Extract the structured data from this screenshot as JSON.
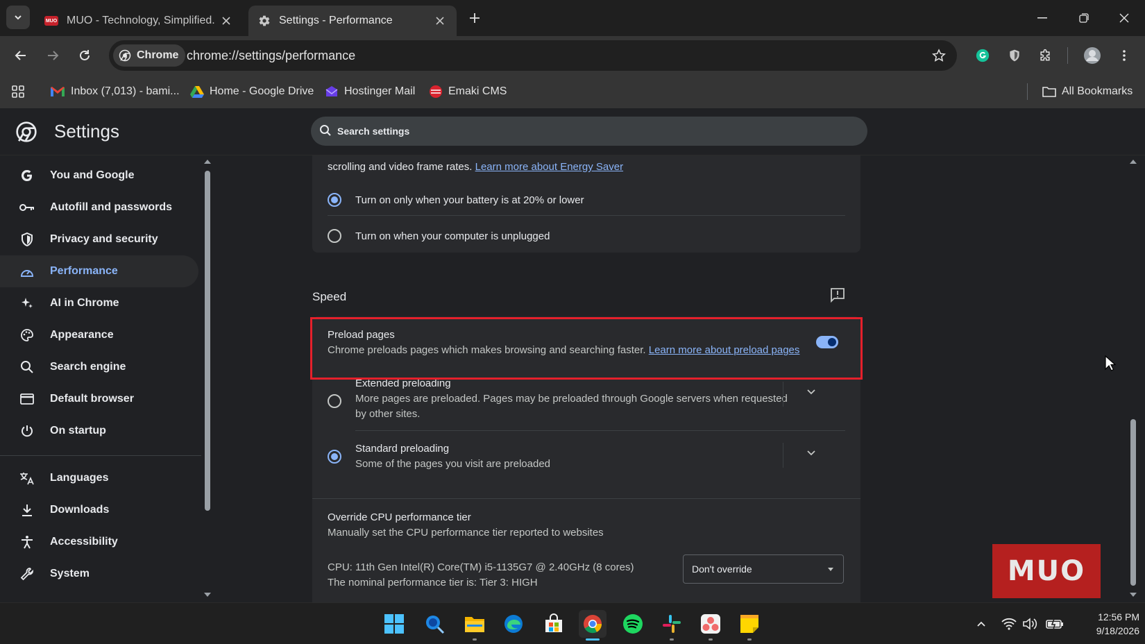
{
  "tabs": [
    {
      "title": "MUO - Technology, Simplified.",
      "favicon": "muo-favicon-icon",
      "active": false
    },
    {
      "title": "Settings - Performance",
      "favicon": "gear-icon",
      "active": true
    }
  ],
  "toolbar": {
    "chip_label": "Chrome",
    "url": "chrome://settings/performance"
  },
  "bookmarks": {
    "items": [
      {
        "label": "Inbox (7,013) - bami...",
        "icon": "gmail-icon"
      },
      {
        "label": "Home - Google Drive",
        "icon": "google-drive-icon"
      },
      {
        "label": "Hostinger Mail",
        "icon": "hostinger-icon"
      },
      {
        "label": "Emaki CMS",
        "icon": "emaki-icon"
      }
    ],
    "all_bookmarks": "All Bookmarks"
  },
  "settings": {
    "title": "Settings",
    "search_placeholder": "Search settings"
  },
  "sidebar": {
    "items": [
      {
        "label": "You and Google",
        "icon": "google-g-icon"
      },
      {
        "label": "Autofill and passwords",
        "icon": "key-icon"
      },
      {
        "label": "Privacy and security",
        "icon": "shield-icon"
      },
      {
        "label": "Performance",
        "icon": "speedometer-icon",
        "active": true
      },
      {
        "label": "AI in Chrome",
        "icon": "sparkle-icon"
      },
      {
        "label": "Appearance",
        "icon": "palette-icon"
      },
      {
        "label": "Search engine",
        "icon": "search-icon"
      },
      {
        "label": "Default browser",
        "icon": "browser-window-icon"
      },
      {
        "label": "On startup",
        "icon": "power-icon"
      },
      {
        "label": "Languages",
        "icon": "translate-icon"
      },
      {
        "label": "Downloads",
        "icon": "download-icon"
      },
      {
        "label": "Accessibility",
        "icon": "accessibility-icon"
      },
      {
        "label": "System",
        "icon": "wrench-icon"
      }
    ]
  },
  "energy": {
    "description_partial": "scrolling and video frame rates.",
    "learn_more": "Learn more about Energy Saver",
    "option_battery": "Turn on only when your battery is at 20% or lower",
    "option_unplugged": "Turn on when your computer is unplugged",
    "selected": "battery"
  },
  "speed": {
    "heading": "Speed",
    "preload": {
      "title": "Preload pages",
      "description": "Chrome preloads pages which makes browsing and searching faster.",
      "learn_more": "Learn more about preload pages",
      "enabled": true
    },
    "extended": {
      "title": "Extended preloading",
      "description_line1": "More pages are preloaded. Pages may be preloaded through Google servers when requested",
      "description_line2": "by other sites."
    },
    "standard": {
      "title": "Standard preloading",
      "description": "Some of the pages you visit are preloaded"
    },
    "selected": "standard"
  },
  "cpu_override": {
    "title": "Override CPU performance tier",
    "description": "Manually set the CPU performance tier reported to websites",
    "cpu_line": "CPU: 11th Gen Intel(R) Core(TM) i5-1135G7 @ 2.40GHz (8 cores)",
    "tier_line": "The nominal performance tier is: Tier 3: HIGH",
    "select_value": "Don't override"
  },
  "watermark": {
    "text": "MUO"
  },
  "taskbar": {
    "apps": [
      "windows-start-icon",
      "search-icon",
      "file-explorer-icon",
      "edge-icon",
      "microsoft-store-icon",
      "chrome-icon",
      "spotify-icon",
      "slack-icon",
      "asana-icon",
      "sticky-notes-icon"
    ],
    "time": "12:56 PM",
    "date": "9/18/2026"
  },
  "colors": {
    "accent": "#8ab4f8",
    "highlight_border": "#e5202b",
    "background": "#202124",
    "card": "#292a2d"
  }
}
